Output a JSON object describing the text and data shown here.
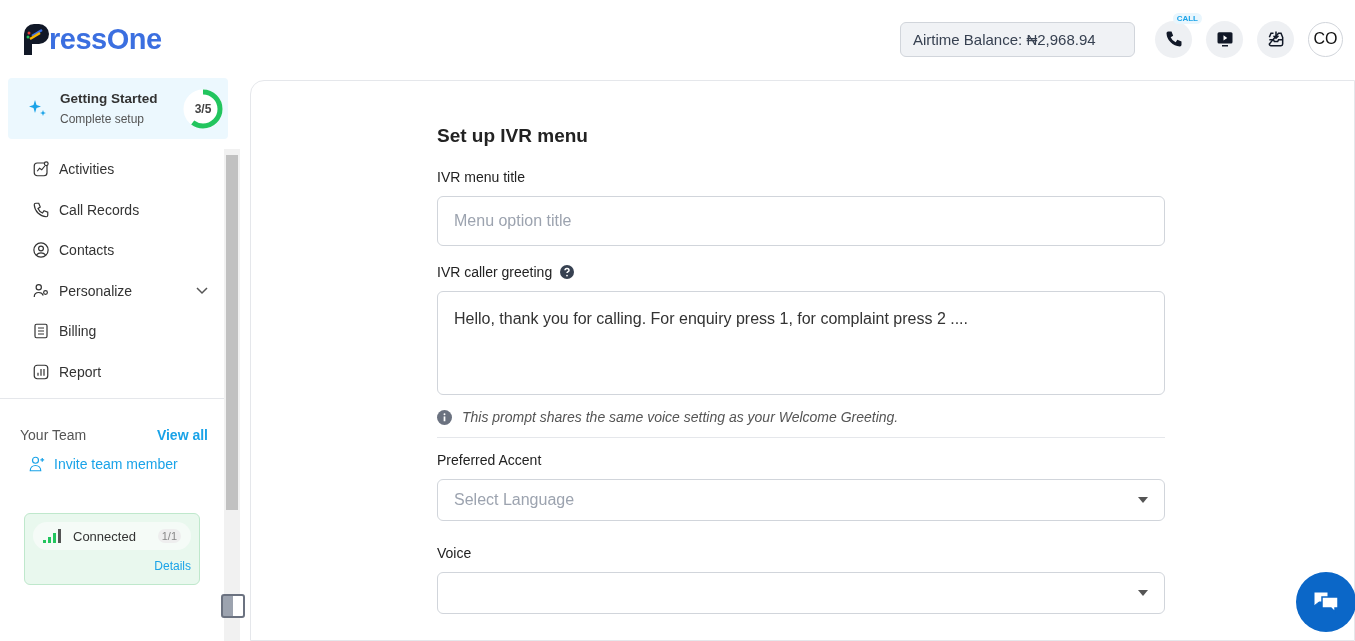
{
  "logo": {
    "text": "ressOne"
  },
  "header": {
    "balance": "Airtime Balance: ₦2,968.94",
    "call_badge": "CALL",
    "avatar": "CO"
  },
  "getting_started": {
    "title": "Getting Started",
    "subtitle": "Complete setup",
    "progress": "3/5"
  },
  "sidebar": {
    "items": [
      {
        "label": "Activities",
        "selected": false
      },
      {
        "label": "Call Records",
        "selected": false
      },
      {
        "label": "Contacts",
        "selected": false
      },
      {
        "label": "Personalize",
        "selected": false,
        "expanded": false
      },
      {
        "label": "Billing",
        "selected": false
      },
      {
        "label": "Report",
        "selected": false
      }
    ],
    "team": {
      "title": "Your Team",
      "view_all": "View all",
      "invite": "Invite team member"
    },
    "connection": {
      "status": "Connected",
      "count": "1/1",
      "details": "Details"
    }
  },
  "form": {
    "title": "Set up IVR menu",
    "fields": [
      {
        "kind": "text",
        "label": "IVR menu title",
        "placeholder": "Menu option title"
      },
      {
        "kind": "textarea",
        "label": "IVR caller greeting",
        "help": true,
        "value": "Hello, thank you for calling. For enquiry press 1, for complaint press 2 ....",
        "note": "This prompt shares the same voice setting as your Welcome Greeting."
      },
      {
        "kind": "select",
        "label": "Preferred Accent",
        "placeholder": "Select Language"
      },
      {
        "kind": "select",
        "label": "Voice"
      }
    ]
  }
}
